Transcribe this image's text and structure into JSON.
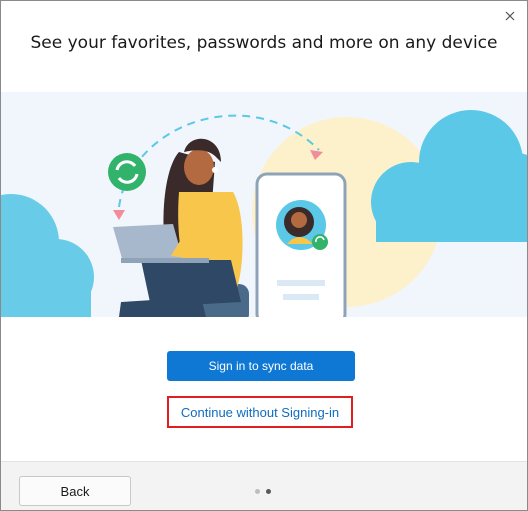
{
  "dialog": {
    "title": "See your favorites, passwords and more on any device",
    "close_icon": "close-icon"
  },
  "illustration": {
    "name": "sync-illustration",
    "colors": {
      "background": "#f1f6fc",
      "cloud": "#5ac8e6",
      "sun": "#fdf1cc",
      "sync_badge": "#31b36b",
      "arrow": "#f28b9a",
      "sweater": "#f7c64a",
      "laptop": "#a8b8cc",
      "phone": "#ffffff"
    }
  },
  "actions": {
    "signin_label": "Sign in to sync data",
    "continue_label": "Continue without Signing-in",
    "accent_color": "#0f78d4",
    "highlight_color": "#e02020"
  },
  "footer": {
    "back_label": "Back",
    "pagination": {
      "current": 2,
      "total": 2
    }
  }
}
